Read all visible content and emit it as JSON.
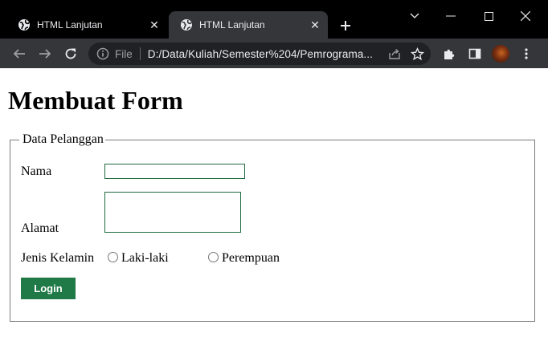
{
  "browser": {
    "tabs": [
      {
        "title": "HTML Lanjutan",
        "active": false
      },
      {
        "title": "HTML Lanjutan",
        "active": true
      }
    ],
    "address_bar": {
      "scheme_label": "File",
      "url": "D:/Data/Kuliah/Semester%204/Pemrograma..."
    },
    "icons": {
      "favicon": "globe-icon",
      "back": "arrow-left-icon",
      "forward": "arrow-right-icon",
      "reload": "reload-icon",
      "info": "info-icon",
      "share": "share-icon",
      "bookmark": "star-icon",
      "extensions": "puzzle-icon",
      "side_panel": "side-panel-icon",
      "menu": "kebab-menu-icon"
    },
    "colors": {
      "titlebar": "#000000",
      "toolbar": "#35363a",
      "omnibox": "#202124"
    }
  },
  "page": {
    "heading": "Membuat Form",
    "form": {
      "legend": "Data Pelanggan",
      "nama_label": "Nama",
      "nama_value": "",
      "alamat_label": "Alamat",
      "alamat_value": "",
      "jenis_kelamin_label": "Jenis Kelamin",
      "gender_options": [
        {
          "label": "Laki-laki",
          "checked": false
        },
        {
          "label": "Perempuan",
          "checked": false
        }
      ],
      "submit_label": "Login"
    },
    "colors": {
      "submit_button": "#1f7a47",
      "input_border": "#1f6b3f"
    }
  }
}
